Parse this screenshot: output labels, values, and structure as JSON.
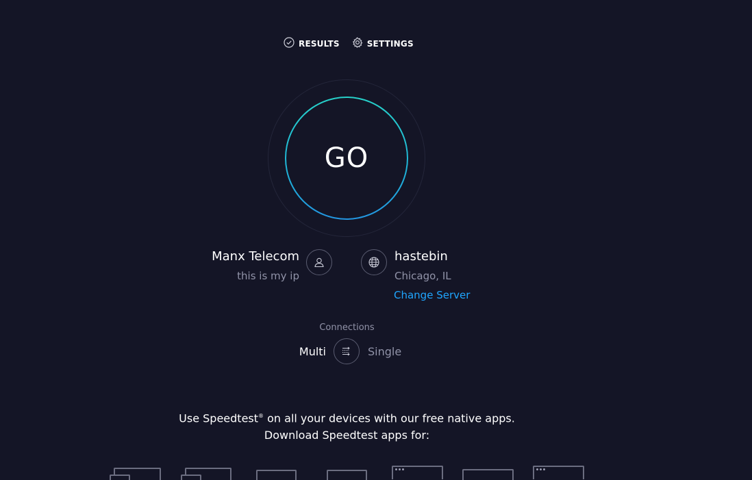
{
  "nav": {
    "results_label": "RESULTS",
    "settings_label": "SETTINGS"
  },
  "go_button": {
    "label": "GO"
  },
  "isp": {
    "name": "Manx Telecom",
    "subtitle": "this is my ip"
  },
  "server": {
    "name": "hastebin",
    "location": "Chicago, IL",
    "change_label": "Change Server"
  },
  "connections": {
    "label": "Connections",
    "multi": "Multi",
    "single": "Single",
    "selected": "Multi"
  },
  "promo": {
    "line1_pre": "Use Speedtest",
    "line1_reg": "®",
    "line1_post": " on all your devices with our free native apps.",
    "line2": "Download Speedtest apps for:"
  },
  "colors": {
    "background": "#141526",
    "accent_link": "#1fa6ff",
    "go_ring_start": "#27d1c9",
    "go_ring_end": "#2396e2"
  },
  "icons": {
    "results": "check-circle-icon",
    "settings": "gear-icon",
    "isp": "user-icon",
    "server": "globe-icon",
    "connections": "connections-toggle-icon"
  }
}
